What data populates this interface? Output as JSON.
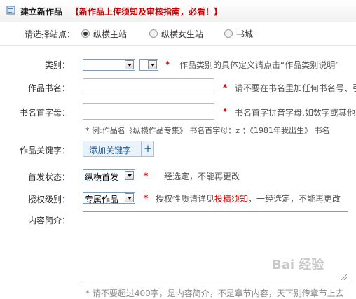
{
  "header": {
    "title": "建立新作品",
    "notice": "【新作品上传须知及审核指南，必看！】"
  },
  "site": {
    "label": "请选择站点：",
    "options": [
      "纵横主站",
      "纵横女生站",
      "书城"
    ],
    "selected": "纵横主站"
  },
  "category": {
    "label": "类别：",
    "value1": "",
    "value2": "",
    "hint": "作品类别的具体定义请点击“作品类别说明”"
  },
  "book_name": {
    "label": "作品书名：",
    "value": "",
    "hint": "请不要在书名里加任何书名号、引"
  },
  "initials": {
    "label": "书名首字母：",
    "value": "",
    "hint": "书名首字拼音字母,如数字或其他",
    "example": "* 例:作品名《纵横作品专集》 书名首字母：z ；《1981年我出生》 书名"
  },
  "keywords": {
    "label": "作品关键字：",
    "button": "添加关键字",
    "plus": "+"
  },
  "first_release": {
    "label": "首发状态：",
    "value": "纵横首发",
    "hint": "一经选定，不能再更改"
  },
  "authorization": {
    "label": "授权级别：",
    "value": "专属作品",
    "hint_prefix": "授权性质请详见",
    "hint_link": "投稿须知",
    "hint_suffix": "，一经选定，不能再更改"
  },
  "intro": {
    "label": "内容简介：",
    "value": "",
    "hint": "* 请不要超过400字，是内容简介，不是章节内容，天下别传章节上去"
  },
  "star": "*",
  "watermark": "Bai 经验"
}
